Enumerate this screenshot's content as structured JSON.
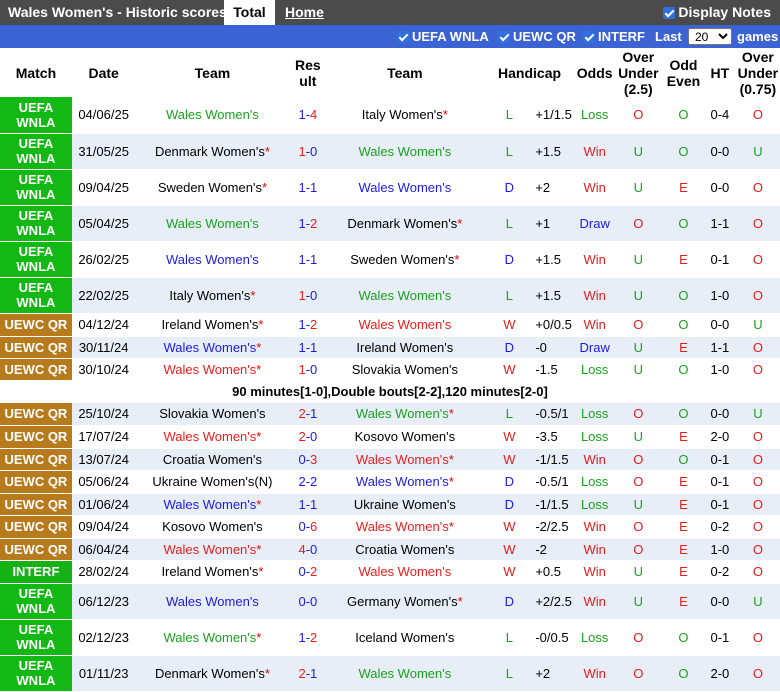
{
  "header": {
    "title": "Wales Women's - Historic scores",
    "tab_total": "Total",
    "tab_home": "Home",
    "display_notes": "Display Notes"
  },
  "filters": {
    "f1": "UEFA WNLA",
    "f2": "UEWC QR",
    "f3": "INTERF",
    "last": "Last",
    "count": "20",
    "games": "games"
  },
  "columns": {
    "match": "Match",
    "date": "Date",
    "team1": "Team",
    "result": "Result",
    "team2": "Team",
    "handicap": "Handicap",
    "odds": "Odds",
    "ou": "Over Under (2.5)",
    "oe": "Odd Even",
    "ht": "HT",
    "ou2": "Over Under (0.75)"
  },
  "colors": {
    "wnla": "#14b814",
    "uewc": "#b77b1d",
    "interf": "#15b215",
    "filterbar": "#3b63d3"
  },
  "rows": [
    {
      "m": "UEFA WNLA",
      "type": "wnla",
      "date": "04/06/25",
      "t1": "Wales Women's",
      "t1c": "green",
      "t1s": false,
      "s1": "1",
      "s2": "4",
      "t2": "Italy Women's",
      "t2c": "home",
      "t2s": true,
      "wl": "L",
      "hc": "+1/1.5",
      "res": "Loss",
      "ou": "O",
      "oe": "O",
      "ht": "0-4",
      "ou2": "O",
      "h": 36
    },
    {
      "m": "UEFA WNLA",
      "type": "wnla",
      "date": "31/05/25",
      "t1": "Denmark Women's",
      "t1c": "home",
      "t1s": true,
      "s1": "1",
      "s2": "0",
      "t2": "Wales Women's",
      "t2c": "green",
      "t2s": false,
      "wl": "L",
      "hc": "+1.5",
      "res": "Win",
      "ou": "U",
      "oe": "O",
      "ht": "0-0",
      "ou2": "U",
      "h": 36
    },
    {
      "m": "UEFA WNLA",
      "type": "wnla",
      "date": "09/04/25",
      "t1": "Sweden Women's",
      "t1c": "home",
      "t1s": true,
      "s1": "1",
      "s2": "1",
      "t2": "Wales Women's",
      "t2c": "blue",
      "t2s": false,
      "wl": "D",
      "hc": "+2",
      "res": "Win",
      "ou": "U",
      "oe": "E",
      "ht": "0-0",
      "ou2": "O",
      "h": 36
    },
    {
      "m": "UEFA WNLA",
      "type": "wnla",
      "date": "05/04/25",
      "t1": "Wales Women's",
      "t1c": "green",
      "t1s": false,
      "s1": "1",
      "s2": "2",
      "t2": "Denmark Women's",
      "t2c": "home",
      "t2s": true,
      "wl": "L",
      "hc": "+1",
      "res": "Draw",
      "ou": "O",
      "oe": "O",
      "ht": "1-1",
      "ou2": "O",
      "h": 36
    },
    {
      "m": "UEFA WNLA",
      "type": "wnla",
      "date": "26/02/25",
      "t1": "Wales Women's",
      "t1c": "blue",
      "t1s": false,
      "s1": "1",
      "s2": "1",
      "t2": "Sweden Women's",
      "t2c": "home",
      "t2s": true,
      "wl": "D",
      "hc": "+1.5",
      "res": "Win",
      "ou": "U",
      "oe": "E",
      "ht": "0-1",
      "ou2": "O",
      "h": 36
    },
    {
      "m": "UEFA WNLA",
      "type": "wnla",
      "date": "22/02/25",
      "t1": "Italy Women's",
      "t1c": "home",
      "t1s": true,
      "s1": "1",
      "s2": "0",
      "t2": "Wales Women's",
      "t2c": "green",
      "t2s": false,
      "wl": "L",
      "hc": "+1.5",
      "res": "Win",
      "ou": "U",
      "oe": "O",
      "ht": "1-0",
      "ou2": "O",
      "h": 36
    },
    {
      "m": "UEWC QR",
      "type": "uewc",
      "date": "04/12/24",
      "t1": "Ireland Women's",
      "t1c": "home",
      "t1s": true,
      "s1": "1",
      "s2": "2",
      "t2": "Wales Women's",
      "t2c": "red",
      "t2s": false,
      "wl": "W",
      "hc": "+0/0.5",
      "res": "Win",
      "ou": "O",
      "oe": "O",
      "ht": "0-0",
      "ou2": "U",
      "h": 23
    },
    {
      "m": "UEWC QR",
      "type": "uewc",
      "date": "30/11/24",
      "t1": "Wales Women's",
      "t1c": "blue",
      "t1s": true,
      "s1": "1",
      "s2": "1",
      "t2": "Ireland Women's",
      "t2c": "home",
      "t2s": false,
      "wl": "D",
      "hc": "-0",
      "res": "Draw",
      "ou": "U",
      "oe": "E",
      "ht": "1-1",
      "ou2": "O",
      "h": 22
    },
    {
      "m": "UEWC QR",
      "type": "uewc",
      "date": "30/10/24",
      "t1": "Wales Women's",
      "t1c": "red",
      "t1s": true,
      "s1": "1",
      "s2": "0",
      "t2": "Slovakia Women's",
      "t2c": "home",
      "t2s": false,
      "wl": "W",
      "hc": "-1.5",
      "res": "Loss",
      "ou": "U",
      "oe": "O",
      "ht": "1-0",
      "ou2": "O",
      "h": 22
    },
    {
      "note": "90 minutes[1-0],Double bouts[2-2],120 minutes[2-0]",
      "h": 21
    },
    {
      "m": "UEWC QR",
      "type": "uewc",
      "date": "25/10/24",
      "t1": "Slovakia Women's",
      "t1c": "home",
      "t1s": false,
      "s1": "2",
      "s2": "1",
      "t2": "Wales Women's",
      "t2c": "green",
      "t2s": true,
      "wl": "L",
      "hc": "-0.5/1",
      "res": "Loss",
      "ou": "O",
      "oe": "O",
      "ht": "0-0",
      "ou2": "U",
      "h": 23
    },
    {
      "m": "UEWC QR",
      "type": "uewc",
      "date": "17/07/24",
      "t1": "Wales Women's",
      "t1c": "red",
      "t1s": true,
      "s1": "2",
      "s2": "0",
      "t2": "Kosovo Women's",
      "t2c": "home",
      "t2s": false,
      "wl": "W",
      "hc": "-3.5",
      "res": "Loss",
      "ou": "U",
      "oe": "E",
      "ht": "2-0",
      "ou2": "O",
      "h": 23
    },
    {
      "m": "UEWC QR",
      "type": "uewc",
      "date": "13/07/24",
      "t1": "Croatia Women's",
      "t1c": "home",
      "t1s": false,
      "s1": "0",
      "s2": "3",
      "t2": "Wales Women's",
      "t2c": "red",
      "t2s": true,
      "wl": "W",
      "hc": "-1/1.5",
      "res": "Win",
      "ou": "O",
      "oe": "O",
      "ht": "0-1",
      "ou2": "O",
      "h": 22
    },
    {
      "m": "UEWC QR",
      "type": "uewc",
      "date": "05/06/24",
      "t1": "Ukraine Women's(N)",
      "t1c": "home",
      "t1s": false,
      "s1": "2",
      "s2": "2",
      "t2": "Wales Women's",
      "t2c": "blue",
      "t2s": true,
      "wl": "D",
      "hc": "-0.5/1",
      "res": "Loss",
      "ou": "O",
      "oe": "E",
      "ht": "0-1",
      "ou2": "O",
      "h": 23
    },
    {
      "m": "UEWC QR",
      "type": "uewc",
      "date": "01/06/24",
      "t1": "Wales Women's",
      "t1c": "blue",
      "t1s": true,
      "s1": "1",
      "s2": "1",
      "t2": "Ukraine Women's",
      "t2c": "home",
      "t2s": false,
      "wl": "D",
      "hc": "-1/1.5",
      "res": "Loss",
      "ou": "U",
      "oe": "E",
      "ht": "0-1",
      "ou2": "O",
      "h": 22
    },
    {
      "m": "UEWC QR",
      "type": "uewc",
      "date": "09/04/24",
      "t1": "Kosovo Women's",
      "t1c": "home",
      "t1s": false,
      "s1": "0",
      "s2": "6",
      "t2": "Wales Women's",
      "t2c": "red",
      "t2s": true,
      "wl": "W",
      "hc": "-2/2.5",
      "res": "Win",
      "ou": "O",
      "oe": "E",
      "ht": "0-2",
      "ou2": "O",
      "h": 23
    },
    {
      "m": "UEWC QR",
      "type": "uewc",
      "date": "06/04/24",
      "t1": "Wales Women's",
      "t1c": "red",
      "t1s": true,
      "s1": "4",
      "s2": "0",
      "t2": "Croatia Women's",
      "t2c": "home",
      "t2s": false,
      "wl": "W",
      "hc": "-2",
      "res": "Win",
      "ou": "O",
      "oe": "E",
      "ht": "1-0",
      "ou2": "O",
      "h": 22
    },
    {
      "m": "INTERF",
      "type": "interf",
      "date": "28/02/24",
      "t1": "Ireland Women's",
      "t1c": "home",
      "t1s": true,
      "s1": "0",
      "s2": "2",
      "t2": "Wales Women's",
      "t2c": "red",
      "t2s": false,
      "wl": "W",
      "hc": "+0.5",
      "res": "Win",
      "ou": "U",
      "oe": "E",
      "ht": "0-2",
      "ou2": "O",
      "h": 23
    },
    {
      "m": "UEFA WNLA",
      "type": "wnla",
      "date": "06/12/23",
      "t1": "Wales Women's",
      "t1c": "blue",
      "t1s": false,
      "s1": "0",
      "s2": "0",
      "t2": "Germany Women's",
      "t2c": "home",
      "t2s": true,
      "wl": "D",
      "hc": "+2/2.5",
      "res": "Win",
      "ou": "U",
      "oe": "E",
      "ht": "0-0",
      "ou2": "U",
      "h": 36
    },
    {
      "m": "UEFA WNLA",
      "type": "wnla",
      "date": "02/12/23",
      "t1": "Wales Women's",
      "t1c": "green",
      "t1s": true,
      "s1": "1",
      "s2": "2",
      "t2": "Iceland Women's",
      "t2c": "home",
      "t2s": false,
      "wl": "L",
      "hc": "-0/0.5",
      "res": "Loss",
      "ou": "O",
      "oe": "O",
      "ht": "0-1",
      "ou2": "O",
      "h": 36
    },
    {
      "m": "UEFA WNLA",
      "type": "wnla",
      "date": "01/11/23",
      "t1": "Denmark Women's",
      "t1c": "home",
      "t1s": true,
      "s1": "2",
      "s2": "1",
      "t2": "Wales Women's",
      "t2c": "green",
      "t2s": false,
      "wl": "L",
      "hc": "+2",
      "res": "Win",
      "ou": "O",
      "oe": "O",
      "ht": "2-0",
      "ou2": "O",
      "h": 36
    }
  ]
}
